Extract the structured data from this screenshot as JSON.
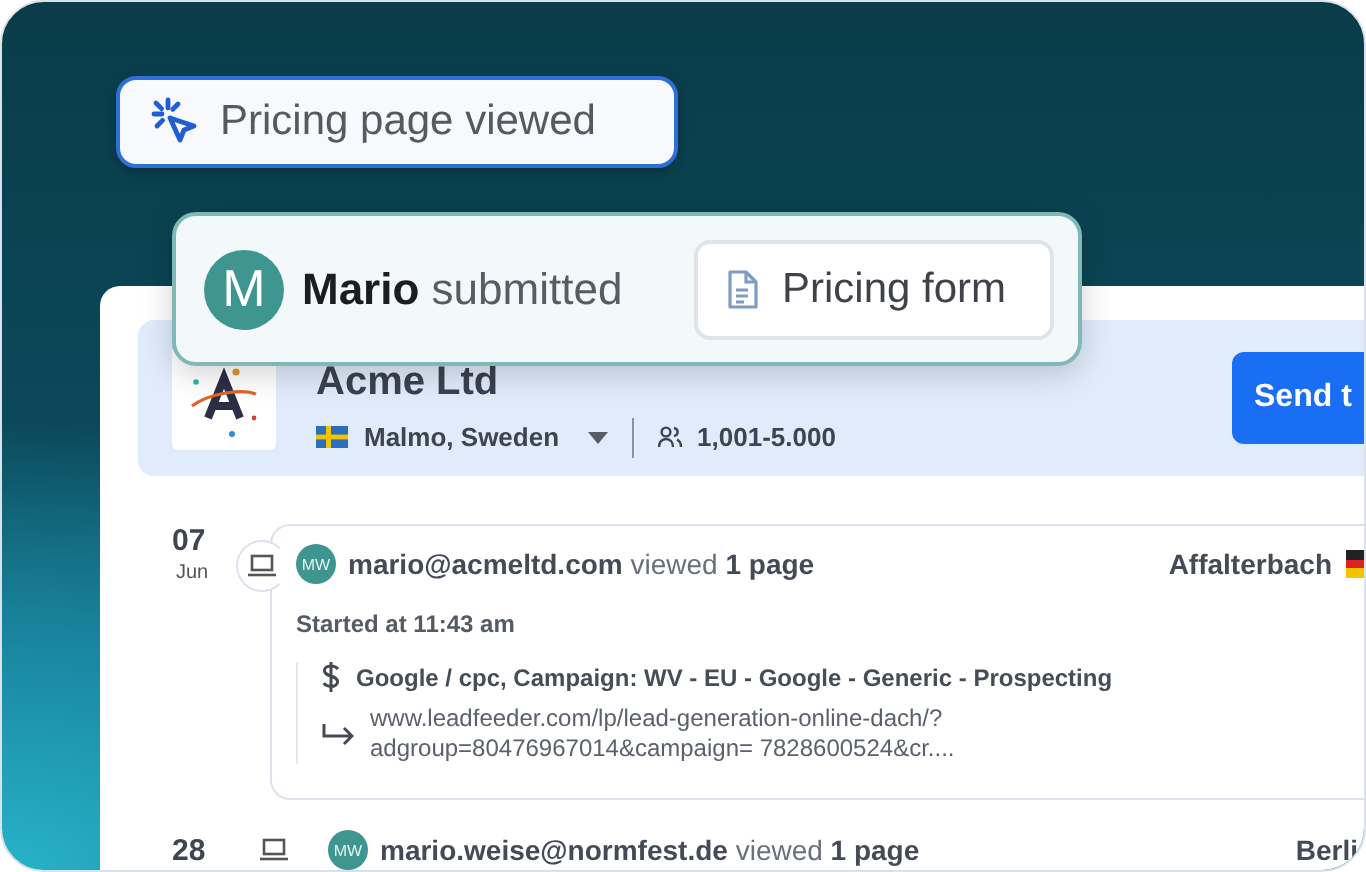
{
  "events": [
    {
      "kind": "page_view",
      "label": "Pricing page viewed"
    },
    {
      "kind": "form",
      "avatar": "M",
      "name": "Mario",
      "action": "submitted",
      "form": "Pricing form"
    }
  ],
  "company": {
    "name": "Acme Ltd",
    "location": "Malmo, Sweden",
    "employees": "1,001-5.000",
    "button": "Send t"
  },
  "timeline": [
    {
      "day": "07",
      "month": "Jun",
      "avatar": "MW",
      "summary": "**mario@acmeltd.com** viewed **1 page**",
      "city": "Affalterbach",
      "started": "Started at 11:43 am",
      "source": "Google / cpc, Campaign: WV - EU - Google - Generic - Prospecting",
      "url_lines": [
        "www.leadfeeder.com/lp/lead-generation-online-dach/?",
        "adgroup=80476967014&campaign= 7828600524&cr...."
      ]
    },
    {
      "day": "28",
      "avatar": "MW",
      "summary": "**mario.weise@normfest.de** viewed **1 page**",
      "city": "Berli"
    }
  ]
}
